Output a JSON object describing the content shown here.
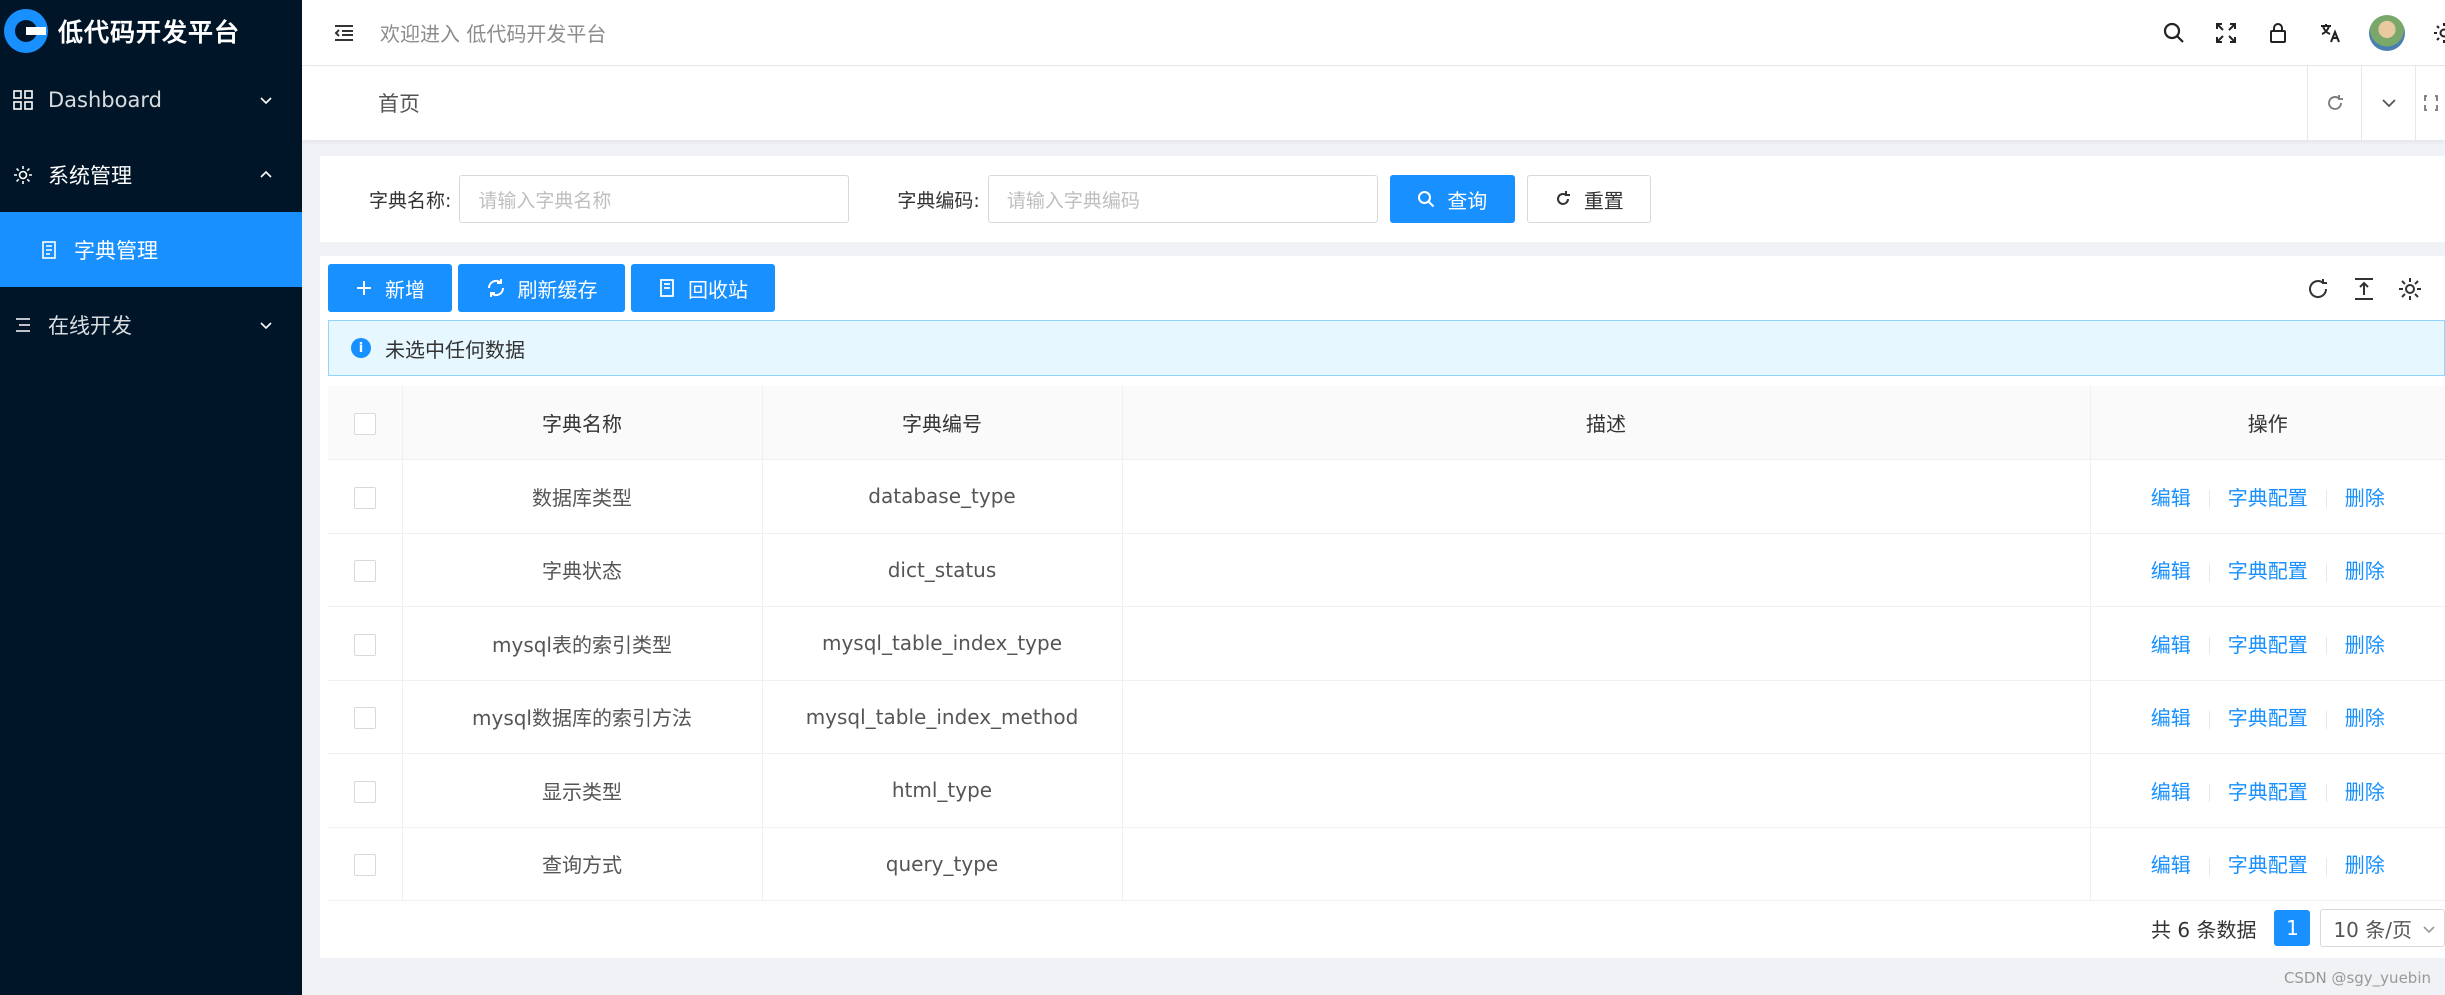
{
  "app": {
    "title": "低代码开发平台"
  },
  "header": {
    "welcome": "欢迎进入 低代码开发平台"
  },
  "sidebar": {
    "items": [
      {
        "label": "Dashboard",
        "icon": "grid-icon"
      },
      {
        "label": "系统管理",
        "icon": "gear-icon"
      },
      {
        "label": "字典管理",
        "icon": "book-icon"
      },
      {
        "label": "在线开发",
        "icon": "list-icon"
      }
    ]
  },
  "tabs": {
    "home": "首页"
  },
  "search": {
    "name_label": "字典名称:",
    "name_placeholder": "请输入字典名称",
    "code_label": "字典编码:",
    "code_placeholder": "请输入字典编码",
    "query_label": "查询",
    "reset_label": "重置"
  },
  "toolbar": {
    "add_label": "新增",
    "refresh_cache_label": "刷新缓存",
    "recycle_label": "回收站"
  },
  "alert": {
    "text": "未选中任何数据"
  },
  "table": {
    "columns": [
      "字典名称",
      "字典编号",
      "描述",
      "操作"
    ],
    "rows": [
      {
        "name": "数据库类型",
        "code": "database_type",
        "desc": ""
      },
      {
        "name": "字典状态",
        "code": "dict_status",
        "desc": ""
      },
      {
        "name": "mysql表的索引类型",
        "code": "mysql_table_index_type",
        "desc": ""
      },
      {
        "name": "mysql数据库的索引方法",
        "code": "mysql_table_index_method",
        "desc": ""
      },
      {
        "name": "显示类型",
        "code": "html_type",
        "desc": ""
      },
      {
        "name": "查询方式",
        "code": "query_type",
        "desc": ""
      }
    ],
    "actions": {
      "edit": "编辑",
      "config": "字典配置",
      "delete": "删除"
    }
  },
  "pagination": {
    "total": "共 6 条数据",
    "current": "1",
    "page_size": "10 条/页"
  },
  "watermark": "CSDN @sgy_yuebin",
  "colors": {
    "primary": "#1890ff",
    "sidebar_bg": "#011528"
  }
}
